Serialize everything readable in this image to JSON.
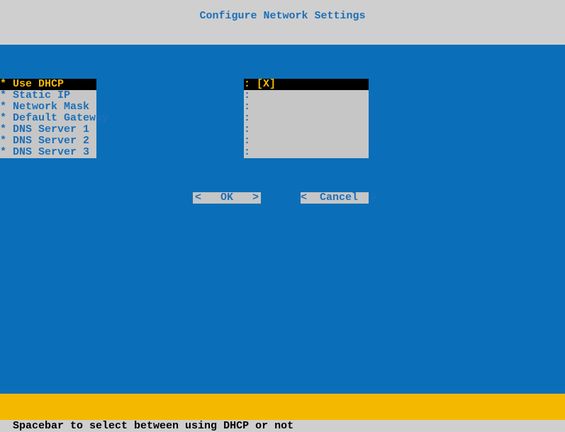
{
  "header": {
    "title": "Configure Network Settings"
  },
  "labels": [
    {
      "text": "* Use DHCP",
      "selected": true
    },
    {
      "text": "* Static IP",
      "selected": false
    },
    {
      "text": "* Network Mask",
      "selected": false
    },
    {
      "text": "* Default Gateway",
      "selected": false
    },
    {
      "text": "* DNS Server 1",
      "selected": false
    },
    {
      "text": "* DNS Server 2",
      "selected": false
    },
    {
      "text": "* DNS Server 3",
      "selected": false
    }
  ],
  "values": [
    {
      "text": ": [X]",
      "selected": true
    },
    {
      "text": ":",
      "selected": false
    },
    {
      "text": ":",
      "selected": false
    },
    {
      "text": ":",
      "selected": false
    },
    {
      "text": ":",
      "selected": false
    },
    {
      "text": ":",
      "selected": false
    },
    {
      "text": ":",
      "selected": false
    }
  ],
  "buttons": {
    "ok": "<   OK   >",
    "cancel": "<  Cancel  >"
  },
  "footer": {
    "hint": "Spacebar to select between using DHCP or not"
  }
}
